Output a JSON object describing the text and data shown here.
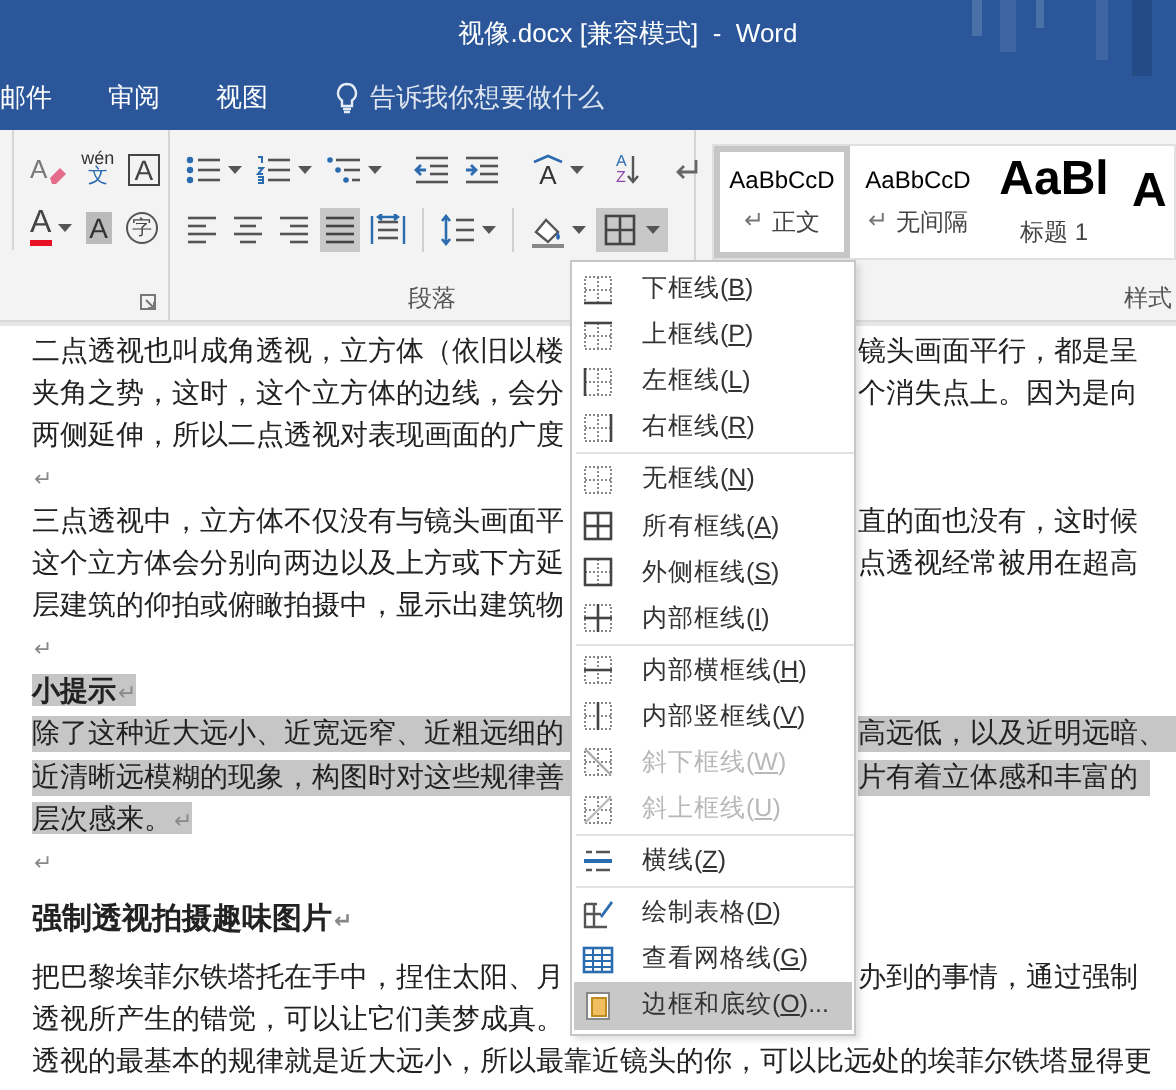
{
  "window": {
    "title": "视像.docx [兼容模式]  -  Word"
  },
  "tabs": [
    {
      "label": "邮件"
    },
    {
      "label": "审阅"
    },
    {
      "label": "视图"
    }
  ],
  "tell_me": {
    "placeholder": "告诉我你想要做什么"
  },
  "ribbon": {
    "font_rows": [
      [
        {
          "kind": "clear-format",
          "glyph": "A"
        },
        {
          "kind": "phonetic",
          "glyph": "wén",
          "glyph2": "文"
        },
        {
          "kind": "boxed",
          "glyph": "A"
        }
      ],
      [
        {
          "kind": "font-color",
          "glyph": "A",
          "caret": true,
          "color": "#e81123"
        },
        {
          "kind": "char-shading",
          "glyph": "A"
        },
        {
          "kind": "enclosed",
          "glyph": "字"
        }
      ]
    ],
    "para_rows": [
      [
        {
          "kind": "bullets",
          "caret": true
        },
        {
          "kind": "numbering",
          "caret": true
        },
        {
          "kind": "multilevel",
          "caret": true
        },
        {
          "kind": "sep"
        },
        {
          "kind": "outdent"
        },
        {
          "kind": "indent"
        },
        {
          "kind": "sep"
        },
        {
          "kind": "asian-layout",
          "glyph": "A",
          "caret": true
        },
        {
          "kind": "sep"
        },
        {
          "kind": "sort",
          "glyph": "A",
          "glyph2": "Z"
        },
        {
          "kind": "sep"
        },
        {
          "kind": "show-marks"
        }
      ],
      [
        {
          "kind": "align-left",
          "selected": false
        },
        {
          "kind": "align-center",
          "selected": false
        },
        {
          "kind": "align-right",
          "selected": false
        },
        {
          "kind": "justify",
          "selected": true
        },
        {
          "kind": "distribute",
          "selected": false
        },
        {
          "kind": "sep"
        },
        {
          "kind": "line-spacing",
          "caret": true
        },
        {
          "kind": "sep"
        },
        {
          "kind": "shading",
          "caret": true
        },
        {
          "kind": "borders",
          "caret": true,
          "selected": true
        }
      ]
    ],
    "para_label": "段落",
    "styles": [
      {
        "sample": "AaBbCcD",
        "label": "正文",
        "pilcrow": "↵",
        "kind": "normal",
        "selected": true
      },
      {
        "sample": "AaBbCcD",
        "label": "无间隔",
        "pilcrow": "↵",
        "kind": "normal",
        "selected": false
      },
      {
        "sample": "AaBl",
        "label": "标题 1",
        "kind": "heading",
        "selected": false
      },
      {
        "sample": "A",
        "kind": "heading",
        "selected": false
      }
    ],
    "styles_label": "样式"
  },
  "document": {
    "lines": [
      {
        "kind": "split",
        "left": "二点透视也叫成角透视，立方体（依旧以楼",
        "right": "镜头画面平行，都是呈"
      },
      {
        "kind": "split",
        "left": "夹角之势，这时，这个立方体的边线，会分",
        "right": "个消失点上。因为是向"
      },
      {
        "kind": "split",
        "left": "两侧延伸，所以二点透视对表现画面的广度"
      },
      {
        "kind": "blank",
        "pilcrow": "↵"
      },
      {
        "kind": "split",
        "left": "三点透视中，立方体不仅没有与镜头画面平",
        "right": "直的面也没有，这时候"
      },
      {
        "kind": "split",
        "left": "这个立方体会分别向两边以及上方或下方延",
        "right": "点透视经常被用在超高"
      },
      {
        "kind": "split",
        "left": "层建筑的仰拍或俯瞰拍摄中，显示出建筑物"
      },
      {
        "kind": "blank",
        "pilcrow": "↵"
      },
      {
        "kind": "heading",
        "left": "小提示",
        "pilcrow": "↵",
        "selected": true
      },
      {
        "kind": "split",
        "left": "除了这种近大远小、近宽远窄、近粗远细的",
        "right": "高远低，以及近明远暗、",
        "selected": true
      },
      {
        "kind": "split",
        "left": "近清晰远模糊的现象，构图时对这些规律善",
        "right": "片有着立体感和丰富的",
        "selected": true
      },
      {
        "kind": "split",
        "left": "层次感来。",
        "pilcrow": "↵",
        "selected": true
      },
      {
        "kind": "blank",
        "pilcrow": "↵"
      },
      {
        "kind": "title",
        "left": "强制透视拍摄趣味图片",
        "pilcrow": "↵"
      },
      {
        "kind": "split",
        "left": "把巴黎埃菲尔铁塔托在手中，捏住太阳、月",
        "right": "办到的事情，通过强制"
      },
      {
        "kind": "split",
        "left": "透视所产生的错觉，可以让它们美梦成真。"
      },
      {
        "kind": "full",
        "left": "透视的最基本的规律就是近大远小，所以最靠近镜头的你，可以比远处的埃菲尔铁塔显得更"
      }
    ]
  },
  "menu": {
    "items": [
      {
        "kind": "bottom",
        "before": "下框线(",
        "key": "B",
        "after": ")",
        "disabled": false,
        "selected": false
      },
      {
        "kind": "top",
        "before": "上框线(",
        "key": "P",
        "after": ")",
        "disabled": false,
        "selected": false
      },
      {
        "kind": "left",
        "before": "左框线(",
        "key": "L",
        "after": ")",
        "disabled": false,
        "selected": false
      },
      {
        "kind": "right",
        "before": "右框线(",
        "key": "R",
        "after": ")",
        "disabled": false,
        "selected": false,
        "separator_after": true
      },
      {
        "kind": "none",
        "before": "无框线(",
        "key": "N",
        "after": ")",
        "disabled": false,
        "selected": false
      },
      {
        "kind": "all",
        "before": "所有框线(",
        "key": "A",
        "after": ")",
        "disabled": false,
        "selected": false
      },
      {
        "kind": "outside",
        "before": "外侧框线(",
        "key": "S",
        "after": ")",
        "disabled": false,
        "selected": false
      },
      {
        "kind": "inside",
        "before": "内部框线(",
        "key": "I",
        "after": ")",
        "disabled": false,
        "selected": false,
        "separator_after": true
      },
      {
        "kind": "inside-h",
        "before": "内部横框线(",
        "key": "H",
        "after": ")",
        "disabled": false,
        "selected": false
      },
      {
        "kind": "inside-v",
        "before": "内部竖框线(",
        "key": "V",
        "after": ")",
        "disabled": false,
        "selected": false
      },
      {
        "kind": "diag-down",
        "before": "斜下框线(",
        "key": "W",
        "after": ")",
        "disabled": true,
        "selected": false
      },
      {
        "kind": "diag-up",
        "before": "斜上框线(",
        "key": "U",
        "after": ")",
        "disabled": true,
        "selected": false,
        "separator_after": true
      },
      {
        "kind": "hline",
        "before": "横线(",
        "key": "Z",
        "after": ")",
        "disabled": false,
        "selected": false,
        "separator_after": true
      },
      {
        "kind": "draw-table",
        "before": "绘制表格(",
        "key": "D",
        "after": ")",
        "disabled": false,
        "selected": false
      },
      {
        "kind": "gridlines",
        "before": "查看网格线(",
        "key": "G",
        "after": ")",
        "disabled": false,
        "selected": false
      },
      {
        "kind": "borders-shading",
        "before": "边框和底纹(",
        "key": "O",
        "after": ")...",
        "disabled": false,
        "selected": true
      }
    ]
  }
}
